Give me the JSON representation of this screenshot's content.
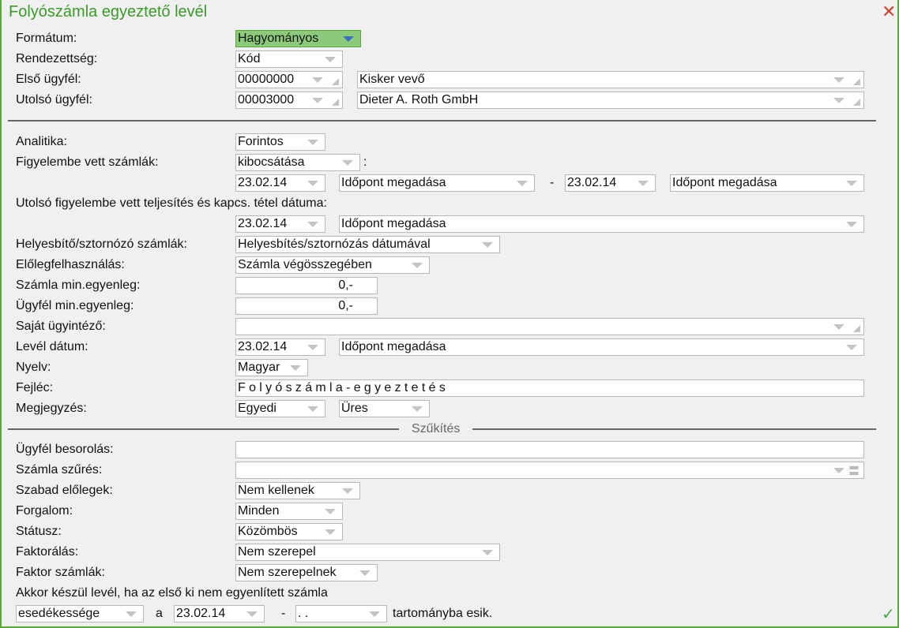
{
  "title": "Folyószámla egyeztető levél",
  "labels": {
    "formatum": "Formátum:",
    "rendezettseg": "Rendezettség:",
    "elso_ugyfel": "Első ügyfél:",
    "utolso_ugyfel": "Utolsó ügyfél:",
    "analitika": "Analitika:",
    "figyelembe": "Figyelembe vett számlák:",
    "utolso_teljesites": "Utolsó figyelembe vett teljesítés és kapcs. tétel dátuma:",
    "helyesbito": "Helyesbítő/sztornózó számlák:",
    "eloleg": "Előlegfelhasználás:",
    "szamla_min": "Számla min.egyenleg:",
    "ugyfel_min": "Ügyfél min.egyenleg:",
    "ugyintezo": "Saját ügyintéző:",
    "level_datum": "Levél dátum:",
    "nyelv": "Nyelv:",
    "fejlec": "Fejléc:",
    "megjegyzes": "Megjegyzés:",
    "szukites": "Szűkítés",
    "besorolas": "Ügyfél besorolás:",
    "szamla_szures": "Számla szűrés:",
    "szabad_elolegek": "Szabad előlegek:",
    "forgalom": "Forgalom:",
    "statusz": "Státusz:",
    "faktoralas": "Faktorálás:",
    "faktor_szamlak": "Faktor számlák:",
    "akkor": "Akkor készül levél, ha az első ki nem egyenlített számla",
    "a": "a",
    "dash": "-",
    "colon": ":",
    "tartomany": "tartományba esik."
  },
  "values": {
    "formatum": "Hagyományos",
    "rendezettseg": "Kód",
    "elso_kod": "00000000",
    "elso_nev": "Kisker vevő",
    "utolso_kod": "00003000",
    "utolso_nev": "Dieter A. Roth GmbH",
    "analitika": "Forintos",
    "figyelembe": "kibocsátása",
    "tol_datum": "23.02.14",
    "tol_idopont": "Időpont megadása",
    "ig_datum": "23.02.14",
    "ig_idopont": "Időpont megadása",
    "telj_datum": "23.02.14",
    "telj_idopont": "Időpont megadása",
    "helyesbito": "Helyesbítés/sztornózás dátumával",
    "eloleg": "Számla végösszegében",
    "szamla_min": "0,-",
    "ugyfel_min": "0,-",
    "ugyintezo": "",
    "level_datum": "23.02.14",
    "level_idopont": "Időpont megadása",
    "nyelv": "Magyar",
    "fejlec": "Folyószámla-egyeztetés",
    "megj1": "Egyedi",
    "megj2": "Üres",
    "besorolas": "",
    "szamla_szures": "",
    "szabad_elolegek": "Nem kellenek",
    "forgalom": "Minden",
    "statusz": "Közömbös",
    "faktoralas": "Nem szerepel",
    "faktor_szamlak": "Nem szerepelnek",
    "esedekesseg": "esedékessége",
    "tart_tol": "23.02.14",
    "tart_ig": ". ."
  },
  "colors": {
    "accent": "#3c9a2a",
    "close": "#d0442c"
  }
}
